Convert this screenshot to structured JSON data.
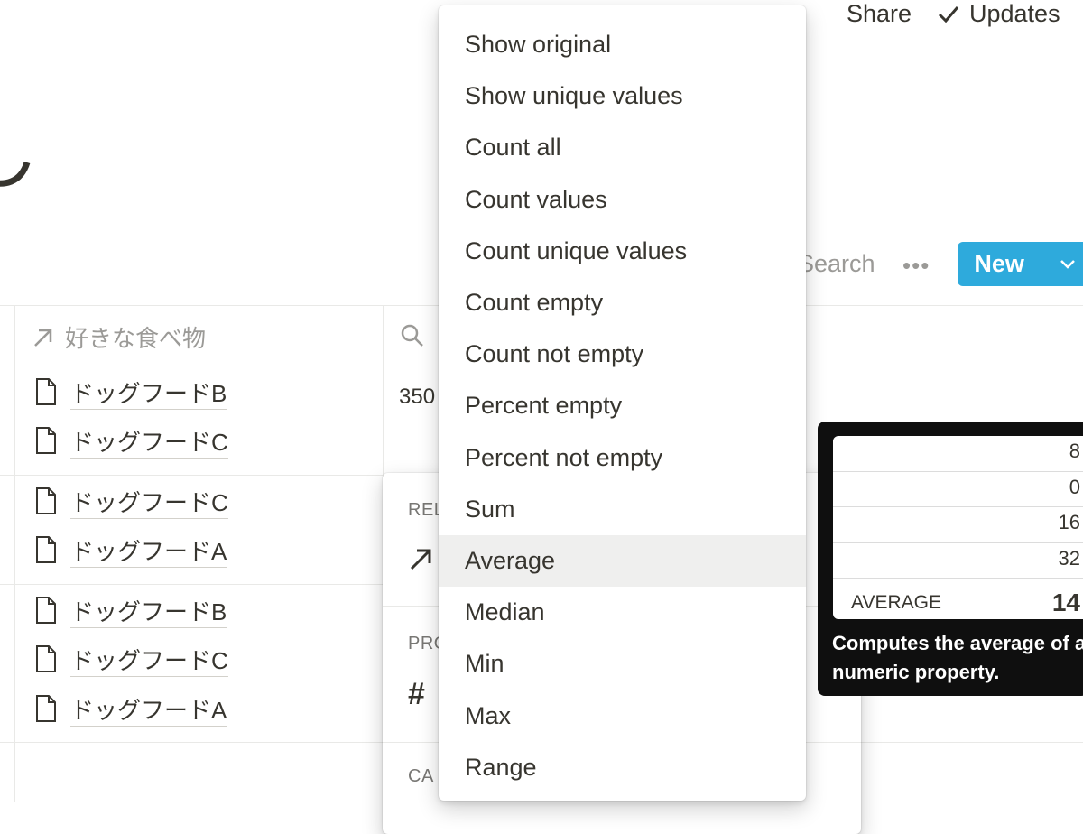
{
  "topbar": {
    "share_label": "Share",
    "updates_label": "Updates"
  },
  "toolbar": {
    "search_label": "Search",
    "more_label": "•••",
    "new_label": "New"
  },
  "table": {
    "column_header": "好きな食べ物",
    "number_cell": "350",
    "rows": [
      {
        "items": [
          "ドッグフードB",
          "ドッグフードC"
        ]
      },
      {
        "items": [
          "ドッグフードC",
          "ドッグフードA"
        ]
      },
      {
        "items": [
          "ドッグフードB",
          "ドッグフードC",
          "ドッグフードA"
        ]
      }
    ]
  },
  "panel": {
    "section1": "REL",
    "section2": "PRO",
    "section3": "CA"
  },
  "menu": {
    "items": [
      "Show original",
      "Show unique values",
      "Count all",
      "Count values",
      "Count unique values",
      "Count empty",
      "Count not empty",
      "Percent empty",
      "Percent not empty",
      "Sum",
      "Average",
      "Median",
      "Min",
      "Max",
      "Range"
    ],
    "active": "Average"
  },
  "tooltip": {
    "values": [
      "8",
      "0",
      "16",
      "32"
    ],
    "agg_label": "AVERAGE",
    "agg_value": "14",
    "description": "Computes the average of a numeric property."
  },
  "colors": {
    "accent": "#2eaadc",
    "text": "#37352f",
    "muted": "#9b9a97",
    "hover": "#efefee"
  }
}
